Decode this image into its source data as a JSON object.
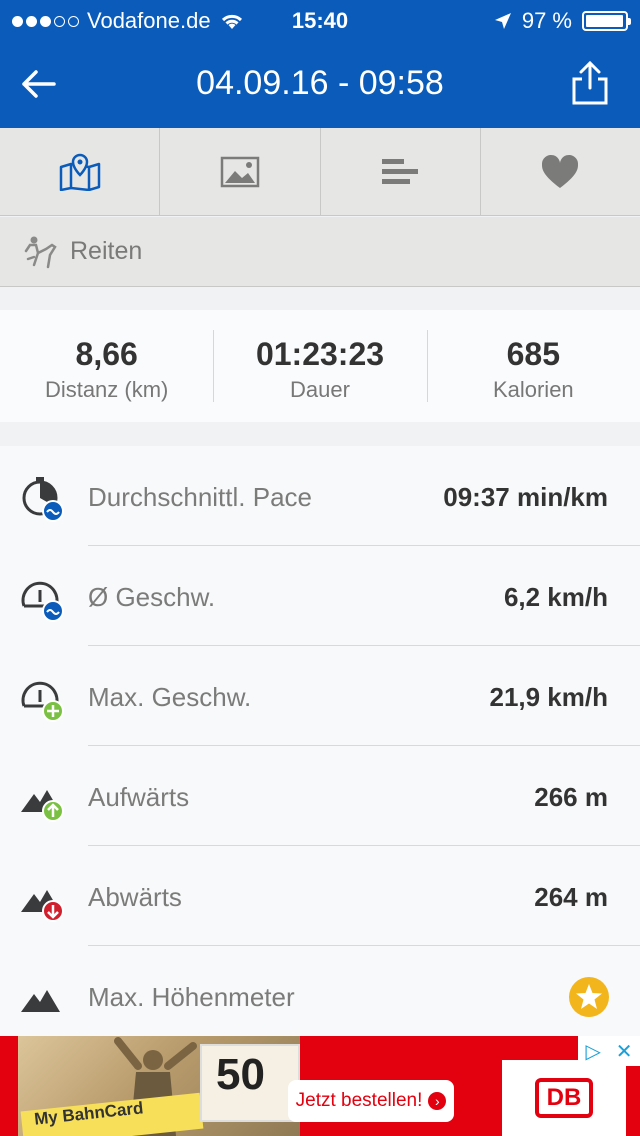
{
  "status": {
    "carrier": "Vodafone.de",
    "time": "15:40",
    "battery": "97 %",
    "battery_level": 0.97,
    "signal_bars": 3
  },
  "header": {
    "title": "04.09.16 - 09:58"
  },
  "tabs": [
    {
      "icon": "map-icon",
      "active": true
    },
    {
      "icon": "photo-icon",
      "active": false
    },
    {
      "icon": "splits-icon",
      "active": false
    },
    {
      "icon": "heart-icon",
      "active": false
    }
  ],
  "activity": {
    "label": "Reiten",
    "icon": "horse-riding-icon"
  },
  "summary": [
    {
      "value": "8,66",
      "label": "Distanz (km)"
    },
    {
      "value": "01:23:23",
      "label": "Dauer"
    },
    {
      "value": "685",
      "label": "Kalorien"
    }
  ],
  "stats": [
    {
      "label": "Durchschnittl. Pace",
      "value": "09:37 min/km",
      "icon": "avg-pace-icon"
    },
    {
      "label": "Ø Geschw.",
      "value": "6,2 km/h",
      "icon": "avg-speed-icon"
    },
    {
      "label": "Max. Geschw.",
      "value": "21,9 km/h",
      "icon": "max-speed-icon"
    },
    {
      "label": "Aufwärts",
      "value": "266 m",
      "icon": "elevation-up-icon"
    },
    {
      "label": "Abwärts",
      "value": "264 m",
      "icon": "elevation-down-icon"
    },
    {
      "label": "Max. Höhenmeter",
      "value": "",
      "icon": "max-elevation-icon"
    }
  ],
  "ad": {
    "card_text": "My BahnCard",
    "big_number": "50",
    "cta": "Jetzt bestellen!",
    "brand": "DB"
  },
  "colors": {
    "brand_blue": "#0b5cba",
    "ad_red": "#e3000f",
    "premium_gold": "#f2b51c"
  }
}
